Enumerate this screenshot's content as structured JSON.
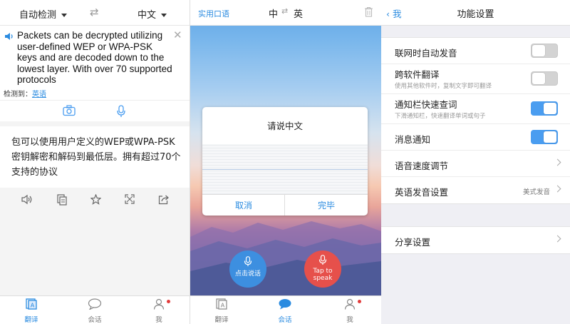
{
  "translate_screen": {
    "source_lang": "自动检测",
    "target_lang": "中文",
    "source_text": "Packets can be decrypted utilizing user-defined WEP or WPA-PSK keys and are decoded down to the lowest layer. With over 70 supported protocols",
    "detected_prefix": "检测到：",
    "detected_lang": "英语",
    "result_text": "包可以使用用户定义的WEP或WPA-PSK密钥解密和解码到最低层。拥有超过70个支持的协议",
    "tabs": [
      "翻译",
      "会话",
      "我"
    ]
  },
  "conversation_screen": {
    "phrases_link": "实用口语",
    "lang_left": "中",
    "lang_right": "英",
    "dialog_title": "请说中文",
    "cancel_label": "取消",
    "done_label": "完毕",
    "speak_cn_label": "点击说话",
    "speak_en_label_1": "Tap to",
    "speak_en_label_2": "speak",
    "tabs": [
      "翻译",
      "会话",
      "我"
    ]
  },
  "settings_screen": {
    "back_label": "我",
    "title": "功能设置",
    "rows": [
      {
        "label": "联网时自动发音",
        "toggle": "off"
      },
      {
        "label": "跨软件翻译",
        "sub": "使用其他软件时，复制文字即可翻译",
        "toggle": "off"
      },
      {
        "label": "通知栏快速查词",
        "sub": "下滑通知栏，快速翻译单词或句子",
        "toggle": "on"
      },
      {
        "label": "消息通知",
        "toggle": "on"
      },
      {
        "label": "语音速度调节"
      },
      {
        "label": "英语发音设置",
        "value": "美式发音"
      },
      {
        "label": "分享设置"
      }
    ]
  },
  "colors": {
    "accent": "#2a8be0",
    "mic_blue": "#3d8fe0",
    "mic_red": "#e6504b",
    "toggle_on": "#4a9df0",
    "badge_red": "#e23b3b"
  }
}
